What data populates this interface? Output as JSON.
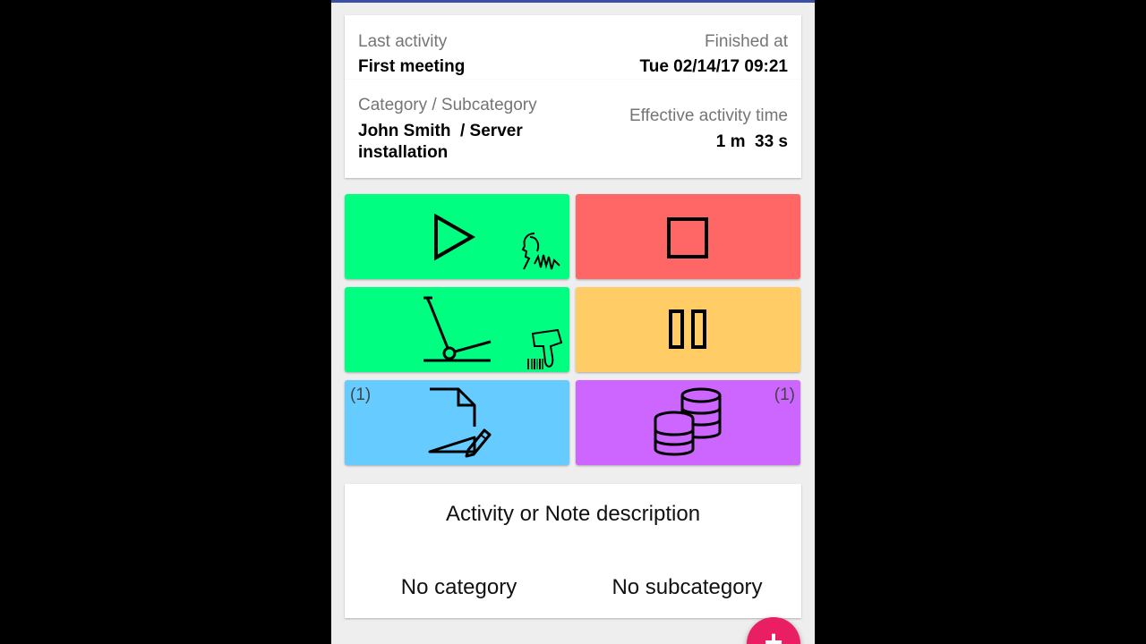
{
  "activity": {
    "last_activity_label": "Last activity",
    "last_activity_value": "First meeting",
    "finished_label": "Finished at",
    "finished_value": "Tue 02/14/17 09:21",
    "category_label": "Category / Subcategory",
    "category_value": "John Smith  / Server installation",
    "effective_label": "Effective activity time",
    "effective_value": "1 m  33 s"
  },
  "tiles": [
    {
      "name": "start-voice",
      "color": "#00ff80",
      "icons": [
        "play-icon",
        "voice-icon"
      ]
    },
    {
      "name": "stop",
      "color": "#ff6666",
      "icons": [
        "stop-icon"
      ]
    },
    {
      "name": "scan",
      "color": "#00ff80",
      "icons": [
        "barcode-scanner-icon",
        "barcode-gun-icon"
      ]
    },
    {
      "name": "pause",
      "color": "#ffcc66",
      "icons": [
        "pause-icon"
      ]
    },
    {
      "name": "notes",
      "color": "#66ccff",
      "icons": [
        "document-edit-icon"
      ],
      "badge": "(1)"
    },
    {
      "name": "expenses",
      "color": "#cc66ff",
      "icons": [
        "coins-stack-icon"
      ],
      "badge": "(1)"
    }
  ],
  "description": {
    "title": "Activity or Note description",
    "category": "No category",
    "subcategory": "No subcategory"
  },
  "fab": {
    "label": "+"
  }
}
